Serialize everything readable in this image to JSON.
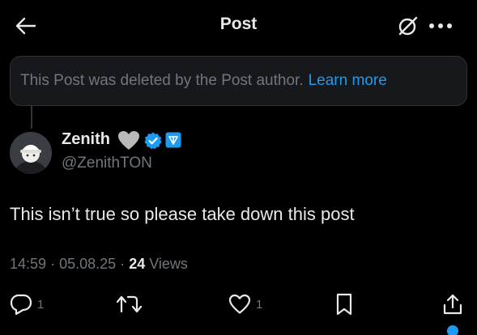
{
  "header": {
    "title": "Post"
  },
  "deleted_notice": {
    "text": "This Post was deleted by the Post author.",
    "link": "Learn more"
  },
  "author": {
    "display_name": "Zenith",
    "handle": "@ZenithTON"
  },
  "post": {
    "text": "This isn’t true so please take down this post"
  },
  "meta": {
    "time": "14:59",
    "separator": "·",
    "date": "05.08.25",
    "views_count": "24",
    "views_label": "Views"
  },
  "actions": {
    "reply_count": "1",
    "like_count": "1"
  },
  "colors": {
    "background": "#000000",
    "accent": "#1d9bf0",
    "muted": "#71767b",
    "text": "#e7e9ea"
  }
}
